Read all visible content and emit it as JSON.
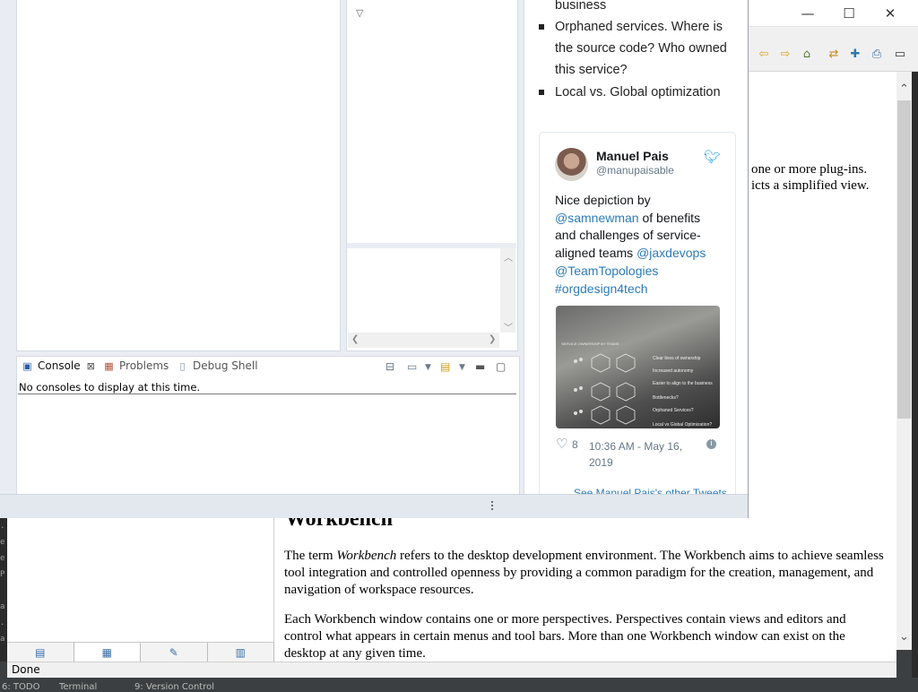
{
  "help_window": {
    "controls": {
      "minimize": "—",
      "maximize": "☐",
      "close": "✕"
    },
    "content": {
      "fragment_1": "one or more plug-ins.",
      "fragment_2": "icts a simplified view.",
      "heading": "Workbench",
      "para1_prefix": "The term ",
      "para1_em": "Workbench",
      "para1_rest": " refers to the desktop development environment. The Workbench aims to achieve seamless tool integration and controlled openness by providing a common paradigm for the creation, management, and navigation of workspace resources.",
      "para2": "Each Workbench window contains one or more perspectives.  Perspectives contain views and editors and control what appears in certain menus and tool bars.  More than one Workbench window can exist on the desktop at any given time."
    },
    "status": "Done"
  },
  "ide_bottom": {
    "todo": "6: TODO",
    "terminal": "Terminal",
    "vcs": "9: Version Control"
  },
  "console_view": {
    "tabs": [
      "Console",
      "Problems",
      "Debug Shell"
    ],
    "message": "No consoles to display at this time."
  },
  "browser": {
    "bullets": [
      "business",
      "Orphaned services. Where is the source code? Who owned this service?",
      "Local vs. Global optimization"
    ],
    "tweet": {
      "name": "Manuel Pais",
      "handle": "@manupaisable",
      "text_1": "Nice depiction by ",
      "mention_1": "@samnewman",
      "text_2": " of benefits and challenges of service-aligned teams ",
      "mention_2": "@jaxdevops",
      "mention_3": "@TeamTopologies",
      "hashtag": "#orgdesign4tech",
      "image_lines": [
        "Clear lines of ownership",
        "Increased autonomy",
        "Easier to align to the business",
        "Bottlenecks?",
        "Orphaned Services?",
        "Local vs Global Optimization?"
      ],
      "image_header": "SERVICE OWNERSHIP BY TEAMS",
      "likes": "8",
      "timestamp": "10:36 AM - May 16, 2019",
      "info_icon": "i",
      "see_more": "See Manuel Pais's other Tweets"
    }
  }
}
